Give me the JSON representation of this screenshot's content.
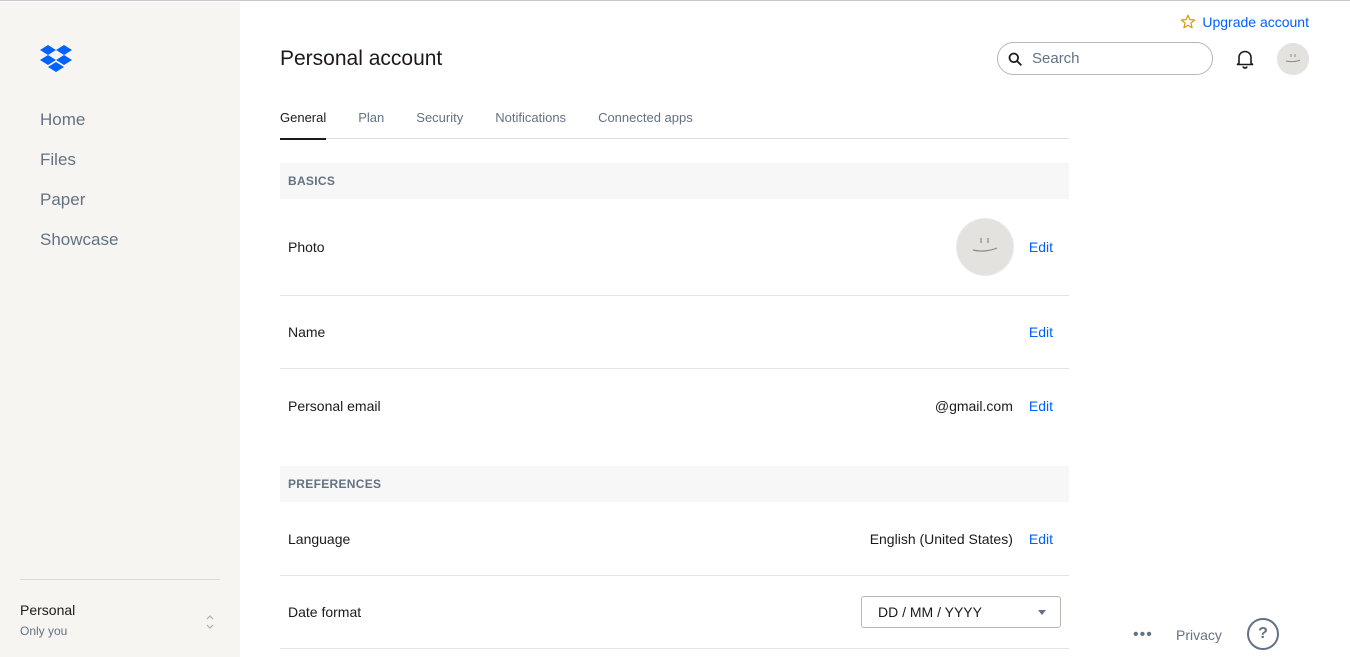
{
  "sidebar": {
    "nav": [
      {
        "label": "Home"
      },
      {
        "label": "Files"
      },
      {
        "label": "Paper"
      },
      {
        "label": "Showcase"
      }
    ],
    "account": {
      "name": "Personal",
      "sub": "Only you"
    }
  },
  "header": {
    "title": "Personal account",
    "upgrade_label": "Upgrade account",
    "search_placeholder": "Search"
  },
  "tabs": [
    {
      "label": "General",
      "active": true
    },
    {
      "label": "Plan"
    },
    {
      "label": "Security"
    },
    {
      "label": "Notifications"
    },
    {
      "label": "Connected apps"
    }
  ],
  "basics": {
    "header": "BASICS",
    "photo_label": "Photo",
    "name_label": "Name",
    "email_label": "Personal email",
    "email_value": "@gmail.com",
    "edit_label": "Edit"
  },
  "preferences": {
    "header": "PREFERENCES",
    "language_label": "Language",
    "language_value": "English (United States)",
    "date_format_label": "Date format",
    "date_format_value": "DD / MM / YYYY",
    "edit_label": "Edit"
  },
  "footer": {
    "more": "•••",
    "privacy": "Privacy",
    "help": "?"
  },
  "colors": {
    "accent": "#0061fe",
    "sidebar_bg": "#f7f5f2",
    "muted_text": "#637282"
  }
}
